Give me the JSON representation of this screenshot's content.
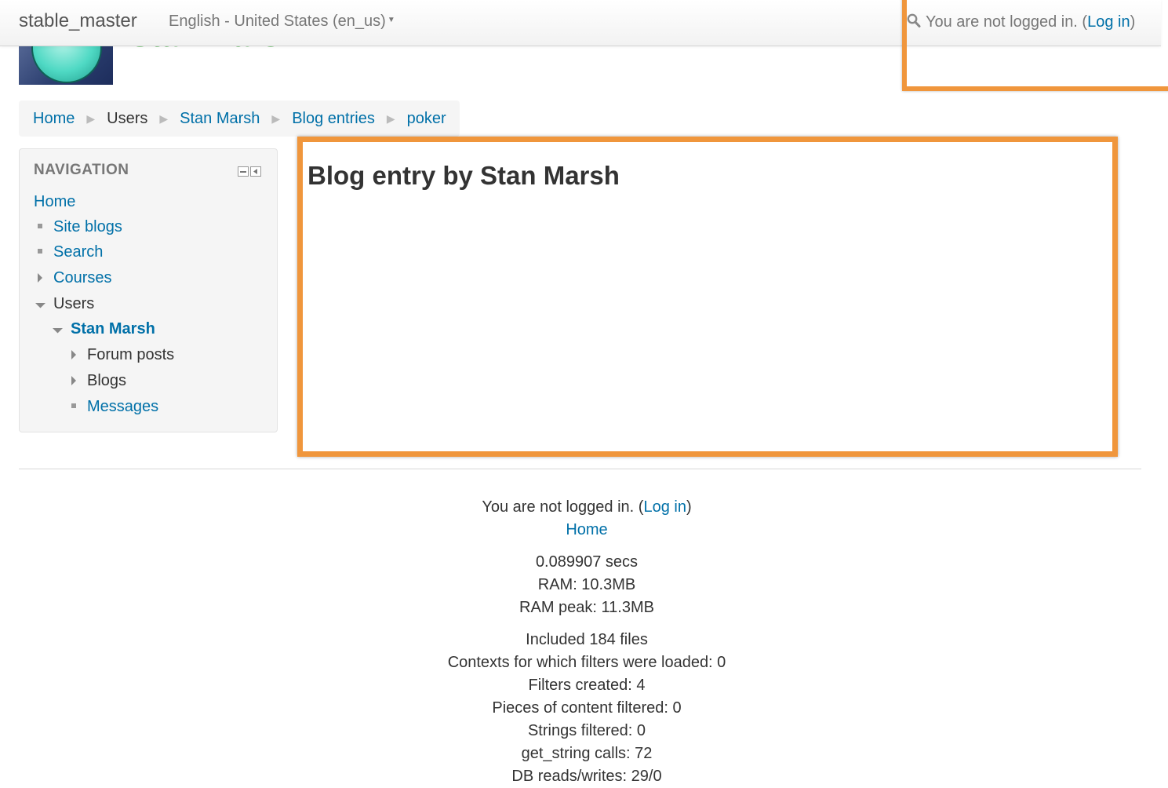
{
  "navbar": {
    "brand": "stable_master",
    "language": "English - United States (en_us)",
    "login_text_prefix": "You are not logged in. (",
    "login_link": "Log in",
    "login_text_suffix": ")"
  },
  "header": {
    "title": "Stan Marsh"
  },
  "breadcrumb": {
    "items": [
      {
        "label": "Home",
        "link": true
      },
      {
        "label": "Users",
        "link": false
      },
      {
        "label": "Stan Marsh",
        "link": true
      },
      {
        "label": "Blog entries",
        "link": true
      },
      {
        "label": "poker",
        "link": true
      }
    ]
  },
  "navigation": {
    "title": "NAVIGATION",
    "items": {
      "home": "Home",
      "site_blogs": "Site blogs",
      "search": "Search",
      "courses": "Courses",
      "users": "Users",
      "stan_marsh": "Stan Marsh",
      "forum_posts": "Forum posts",
      "blogs": "Blogs",
      "messages": "Messages"
    }
  },
  "main": {
    "heading": "Blog entry by Stan Marsh"
  },
  "footer": {
    "login_text_prefix": "You are not logged in. (",
    "login_link": "Log in",
    "login_text_suffix": ")",
    "home_link": "Home",
    "perf": {
      "secs": "0.089907 secs",
      "ram": "RAM: 10.3MB",
      "ram_peak": "RAM peak: 11.3MB",
      "included": "Included 184 files",
      "contexts": "Contexts for which filters were loaded: 0",
      "filters_created": "Filters created: 4",
      "pieces": "Pieces of content filtered: 0",
      "strings": "Strings filtered: 0",
      "get_string": "get_string calls: 72",
      "db_partial": "DB reads/writes: 29/0"
    }
  },
  "colors": {
    "link": "#0070a8",
    "highlight": "#f0963c",
    "title_green": "#1a9a1a"
  }
}
